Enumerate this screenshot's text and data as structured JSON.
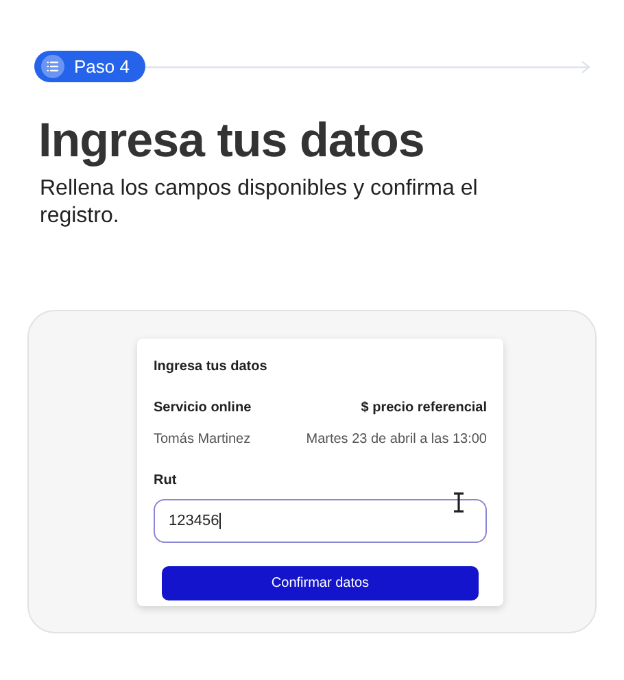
{
  "step_badge": {
    "label": "Paso 4"
  },
  "heading": "Ingresa tus datos",
  "subtitle": "Rellena los campos disponibles y confirma el registro.",
  "form_card": {
    "title": "Ingresa tus datos",
    "service": "Servicio online",
    "price": "$ precio referencial",
    "person": "Tomás Martinez",
    "date": "Martes 23 de abril a las 13:00",
    "field": {
      "label": "Rut",
      "value": "123456",
      "focused": true
    },
    "button": "Confirmar datos"
  }
}
